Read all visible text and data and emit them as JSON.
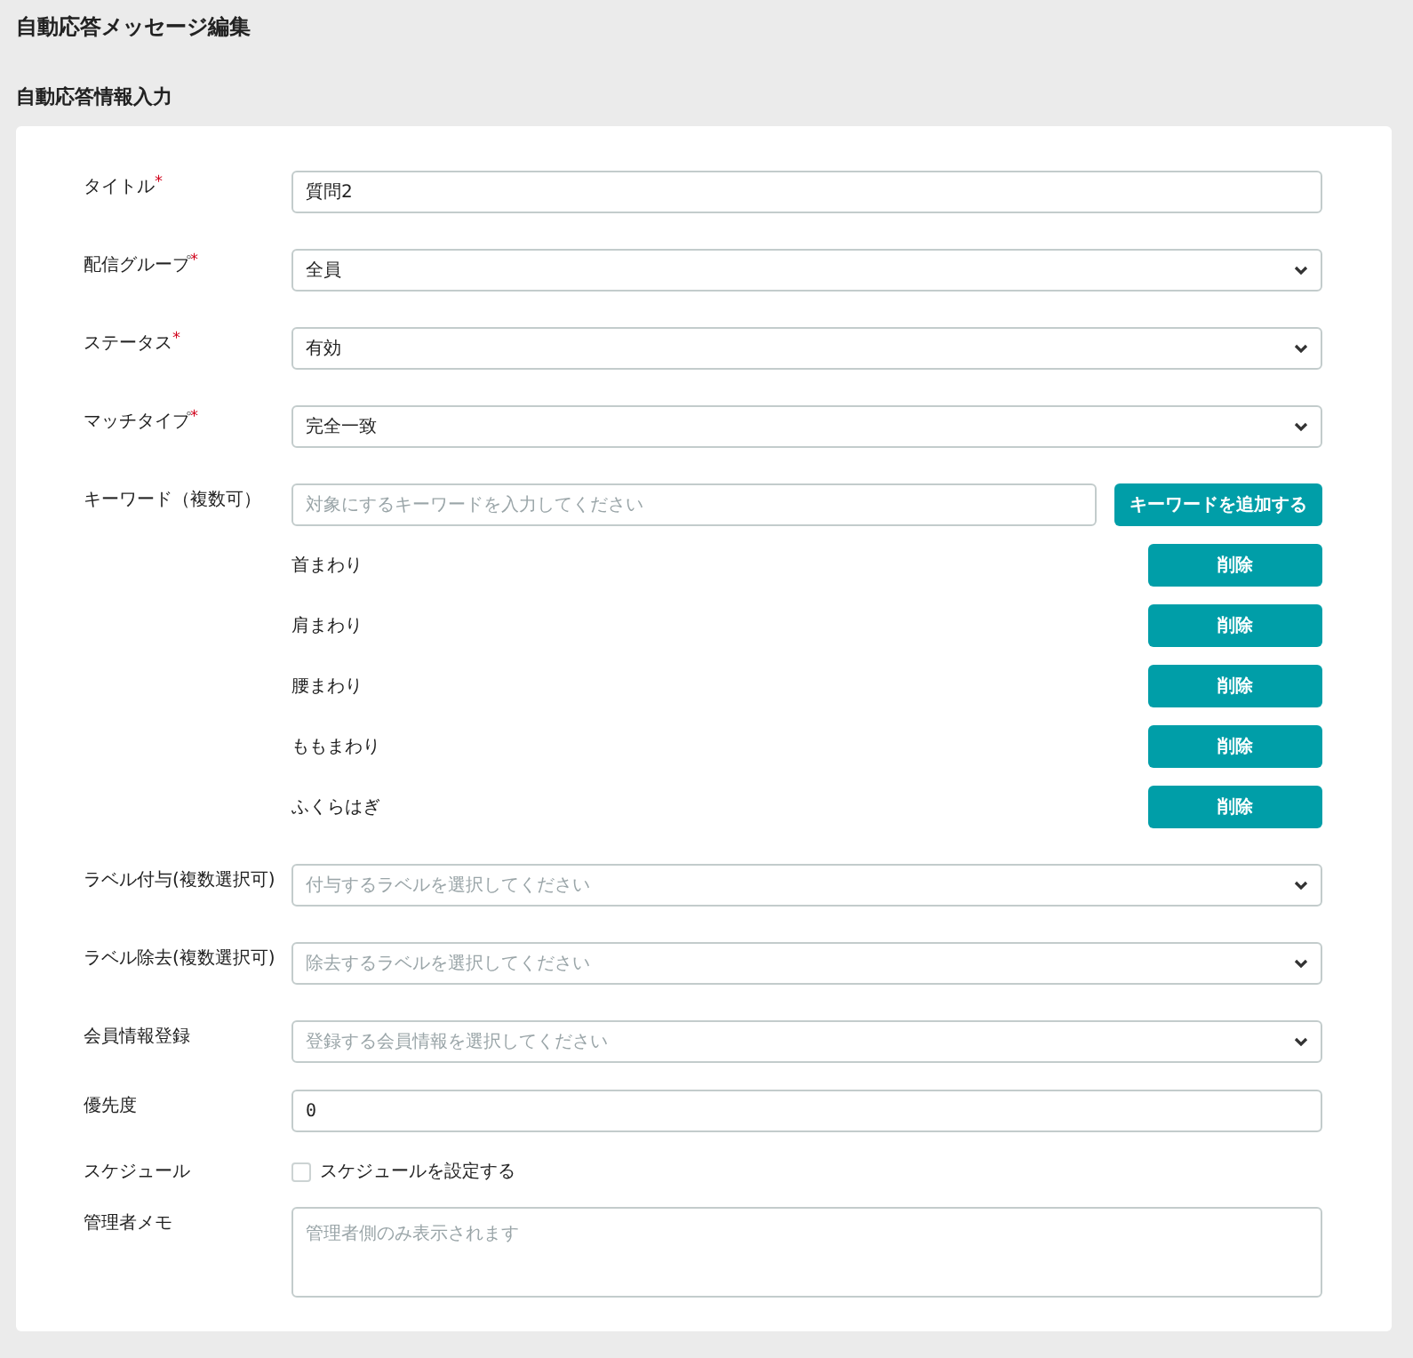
{
  "page_title": "自動応答メッセージ編集",
  "section_title": "自動応答情報入力",
  "required_mark": "*",
  "fields": [
    {
      "kind": "text",
      "label": "タイトル",
      "required": true,
      "value": "質問2"
    },
    {
      "kind": "select",
      "label": "配信グループ",
      "required": true,
      "value": "全員"
    },
    {
      "kind": "select",
      "label": "ステータス",
      "required": true,
      "value": "有効"
    },
    {
      "kind": "select",
      "label": "マッチタイプ",
      "required": true,
      "value": "完全一致"
    },
    {
      "kind": "keywords",
      "label": "キーワード（複数可）",
      "required": false,
      "placeholder": "対象にするキーワードを入力してください",
      "add_button": "キーワードを追加する",
      "keywords": [
        {
          "text": "首まわり",
          "delete_button": "削除"
        },
        {
          "text": "肩まわり",
          "delete_button": "削除"
        },
        {
          "text": "腰まわり",
          "delete_button": "削除"
        },
        {
          "text": "ももまわり",
          "delete_button": "削除"
        },
        {
          "text": "ふくらはぎ",
          "delete_button": "削除"
        }
      ]
    },
    {
      "kind": "select",
      "label": "ラベル付与(複数選択可)",
      "required": false,
      "placeholder": "付与するラベルを選択してください"
    },
    {
      "kind": "select",
      "label": "ラベル除去(複数選択可)",
      "required": false,
      "placeholder": "除去するラベルを選択してください"
    },
    {
      "kind": "select",
      "label": "会員情報登録",
      "required": false,
      "placeholder": "登録する会員情報を選択してください"
    },
    {
      "kind": "number",
      "label": "優先度",
      "required": false,
      "value": "0"
    },
    {
      "kind": "checkbox",
      "label": "スケジュール",
      "required": false,
      "option": "スケジュールを設定する",
      "checked": false
    },
    {
      "kind": "textarea",
      "label": "管理者メモ",
      "required": false,
      "placeholder": "管理者側のみ表示されます"
    }
  ]
}
